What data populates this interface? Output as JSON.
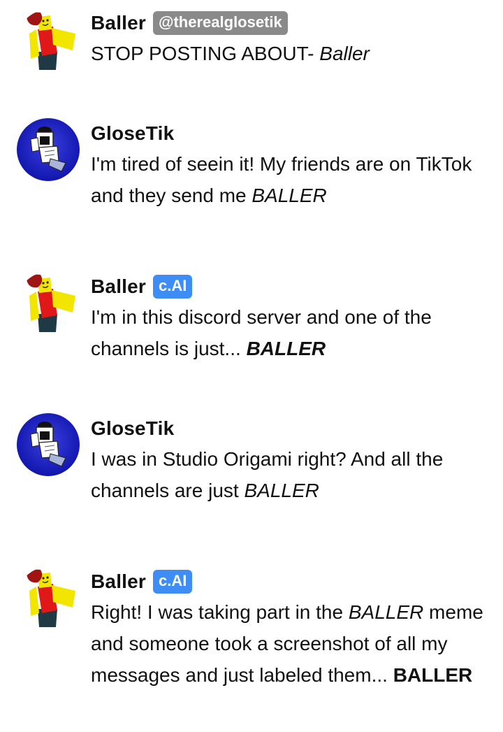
{
  "messages": [
    {
      "author": "Baller",
      "badge": "@therealglosetik",
      "badge_type": "handle",
      "avatar": "baller-avatar",
      "parts": [
        {
          "t": "STOP POSTING ABOUT- ",
          "s": "normal"
        },
        {
          "t": "Baller",
          "s": "italic"
        }
      ]
    },
    {
      "author": "GloseTik",
      "badge": "",
      "badge_type": "none",
      "avatar": "glosetik-avatar",
      "parts": [
        {
          "t": "I'm tired of seein it! My friends are on TikTok and they send me ",
          "s": "normal"
        },
        {
          "t": "BALLER",
          "s": "italic"
        }
      ]
    },
    {
      "author": "Baller",
      "badge": "c.AI",
      "badge_type": "cai",
      "avatar": "baller-avatar",
      "parts": [
        {
          "t": "I'm in this discord server and one of the channels is just... ",
          "s": "normal"
        },
        {
          "t": "BALLER",
          "s": "bolditalic"
        }
      ]
    },
    {
      "author": "GloseTik",
      "badge": "",
      "badge_type": "none",
      "avatar": "glosetik-avatar",
      "parts": [
        {
          "t": "I was in Studio Origami right? And all the channels are just ",
          "s": "normal"
        },
        {
          "t": "BALLER",
          "s": "italic"
        }
      ]
    },
    {
      "author": "Baller",
      "badge": "c.AI",
      "badge_type": "cai",
      "avatar": "baller-avatar",
      "parts": [
        {
          "t": "Right! I was taking part in the ",
          "s": "normal"
        },
        {
          "t": "BALLER",
          "s": "italic"
        },
        {
          "t": " meme and someone took a screenshot of all my messages and just labeled them... ",
          "s": "normal"
        },
        {
          "t": "BALLER",
          "s": "bold"
        }
      ]
    }
  ],
  "colors": {
    "badge_handle": "#8a8a8a",
    "badge_cai": "#3d8df5",
    "glosetik_bg": "#1a1fc8"
  }
}
